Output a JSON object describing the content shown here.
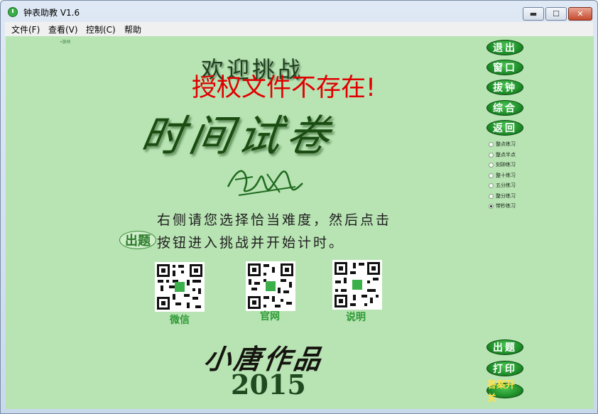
{
  "window": {
    "title": "钟表助教 V1.6",
    "controls": {
      "minimize": "▬",
      "maximize": "☐",
      "close": "✕"
    }
  },
  "menu": [
    "文件(F)",
    "查看(V)",
    "控制(C)",
    "帮助"
  ],
  "main": {
    "tiny_note": "•旗林",
    "welcome": "欢迎挑战",
    "warning": "授权文件不存在!",
    "big_title": "时间试卷",
    "instruction_line1": "右侧请您选择恰当难度，然后点击",
    "instruction_line2": "按钮进入挑战并开始计时。",
    "inline_button_label": "出题",
    "qr_codes": [
      {
        "label": "微信"
      },
      {
        "label": "官网"
      },
      {
        "label": "说明"
      }
    ],
    "works": "小唐作品",
    "year": "2015"
  },
  "side_buttons_top": [
    "退出",
    "窗口",
    "拔钟",
    "综合",
    "返回"
  ],
  "difficulty_options": [
    "整点练习",
    "整点半点",
    "刻钟练习",
    "整十练习",
    "五分练习",
    "整分练习",
    "带秒练习"
  ],
  "difficulty_selected": 6,
  "side_buttons_bottom": [
    "出题",
    "打印",
    "答案开关"
  ],
  "colors": {
    "background": "#b8e3b3",
    "button_green": "#1f8f2a",
    "warning": "#e00000",
    "qr_label": "#2e9a36"
  }
}
